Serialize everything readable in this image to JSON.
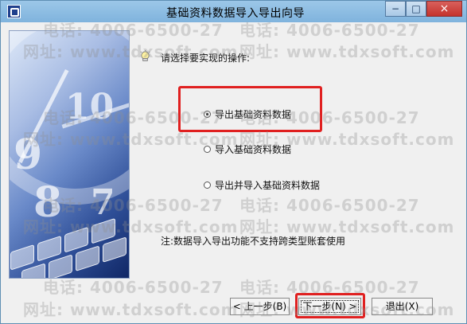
{
  "window": {
    "title": "基础资料数据导入导出向导",
    "controls": {
      "minimize": "−",
      "maximize": "□",
      "close": "×"
    }
  },
  "wizard": {
    "prompt": "请选择要实现的操作:",
    "options": [
      {
        "label": "导出基础资料数据",
        "selected": true
      },
      {
        "label": "导入基础资料数据",
        "selected": false
      },
      {
        "label": "导出并导入基础资料数据",
        "selected": false
      }
    ],
    "note": "注:数据导入导出功能不支持跨类型账套使用"
  },
  "buttons": {
    "back": "< 上一步(B)",
    "next": "下一步(N) >",
    "exit": "退出(X)"
  },
  "watermark": {
    "line1": "电话: 4006-6500-27",
    "line2": "网址: www.tdxsoft.com"
  },
  "colors": {
    "title_bar": "#8fbfe6",
    "highlight": "#e02020",
    "window": "#f0f0f0"
  },
  "icons": {
    "app": "app-icon",
    "prompt": "lightbulb-icon",
    "close": "close-icon"
  }
}
